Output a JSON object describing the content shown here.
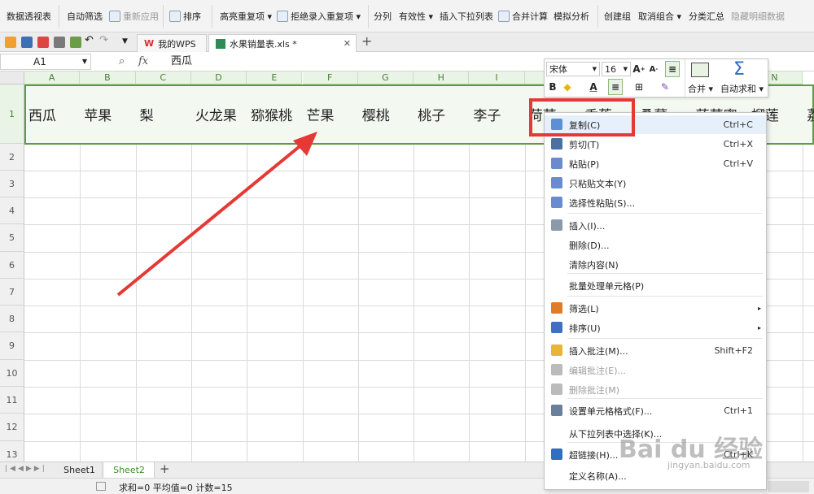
{
  "ribbon": {
    "items": [
      "数据透视表",
      "自动筛选",
      "重新应用",
      "排序",
      "高亮重复项 ▾",
      "拒绝录入重复项 ▾",
      "分列",
      "有效性 ▾",
      "插入下拉列表",
      "合并计算",
      "模拟分析",
      "创建组",
      "取消组合 ▾",
      "分类汇总",
      "隐藏明细数据"
    ]
  },
  "tabs": {
    "wps": "我的WPS",
    "file": "水果销量表.xls *",
    "new": "+"
  },
  "formula": {
    "cell_ref": "A1",
    "fx": "fx",
    "value": "西瓜"
  },
  "columns": [
    "A",
    "B",
    "C",
    "D",
    "E",
    "F",
    "G",
    "H",
    "I",
    "J",
    "K",
    "L",
    "M",
    "N"
  ],
  "rows": [
    "1",
    "2",
    "3",
    "4",
    "5",
    "6",
    "7",
    "8",
    "9",
    "10",
    "11",
    "12",
    "13"
  ],
  "cells": [
    "西瓜",
    "苹果",
    "梨",
    "火龙果",
    "猕猴桃",
    "芒果",
    "樱桃",
    "桃子",
    "李子",
    "荷萝",
    "香蕉",
    "桑葚",
    "菠萝蜜",
    "榴莲",
    "荔"
  ],
  "mini": {
    "font": "宋体",
    "size": "16",
    "merge": "合并 ▾",
    "autosum": "自动求和 ▾"
  },
  "menu": [
    {
      "label": "复制(C)",
      "shortcut": "Ctrl+C",
      "icon": "copy-icon"
    },
    {
      "label": "剪切(T)",
      "shortcut": "Ctrl+X",
      "icon": "scissors-icon"
    },
    {
      "label": "粘贴(P)",
      "shortcut": "Ctrl+V",
      "icon": "paste-icon"
    },
    {
      "label": "只粘贴文本(Y)",
      "shortcut": "",
      "icon": "paste-text-icon"
    },
    {
      "label": "选择性粘贴(S)...",
      "shortcut": "",
      "icon": "paste-special-icon"
    },
    {
      "label": "插入(I)...",
      "shortcut": "",
      "icon": "insert-icon"
    },
    {
      "label": "删除(D)...",
      "shortcut": "",
      "icon": ""
    },
    {
      "label": "清除内容(N)",
      "shortcut": "",
      "icon": ""
    },
    {
      "label": "批量处理单元格(P)",
      "shortcut": "",
      "icon": ""
    },
    {
      "label": "筛选(L)",
      "shortcut": "",
      "icon": "filter-icon",
      "arrow": "▸"
    },
    {
      "label": "排序(U)",
      "shortcut": "",
      "icon": "sort-icon",
      "arrow": "▸"
    },
    {
      "label": "插入批注(M)...",
      "shortcut": "Shift+F2",
      "icon": "comment-icon"
    },
    {
      "label": "编辑批注(E)...",
      "shortcut": "",
      "icon": "edit-comment-icon",
      "disabled": true
    },
    {
      "label": "删除批注(M)",
      "shortcut": "",
      "icon": "delete-comment-icon",
      "disabled": true
    },
    {
      "label": "设置单元格格式(F)...",
      "shortcut": "Ctrl+1",
      "icon": "format-cells-icon"
    },
    {
      "label": "从下拉列表中选择(K)...",
      "shortcut": "",
      "icon": ""
    },
    {
      "label": "超链接(H)...",
      "shortcut": "Ctrl+K",
      "icon": "hyperlink-icon"
    },
    {
      "label": "定义名称(A)...",
      "shortcut": "",
      "icon": ""
    }
  ],
  "sheets": [
    "Sheet1",
    "Sheet2"
  ],
  "status": "求和=0  平均值=0  计数=15",
  "watermark": {
    "brand": "Bai du 经验",
    "url": "jingyan.baidu.com"
  },
  "colors": {
    "accent_green": "#4b7d36",
    "highlight_red": "#e53935",
    "menu_hover": "#e6f0fb"
  }
}
